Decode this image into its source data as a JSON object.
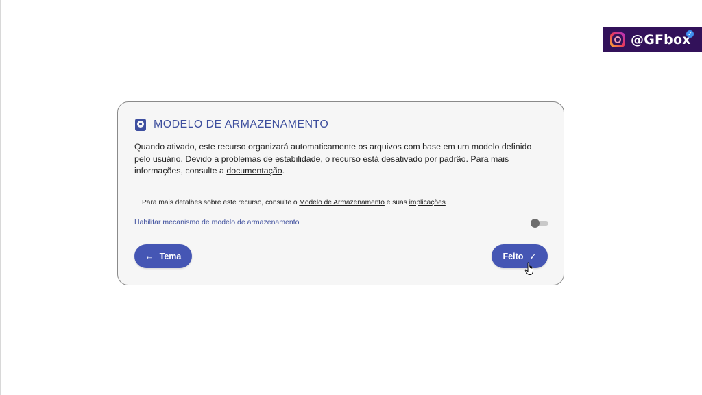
{
  "watermark": {
    "handle": "@GFbox",
    "icon": "instagram-icon",
    "verified_icon": "verified-badge-icon"
  },
  "dialog": {
    "icon": "storage-disk-icon",
    "title": "MODELO DE ARMAZENAMENTO",
    "description_before_link": "Quando ativado, este recurso organizará automaticamente os arquivos com base em um modelo definido pelo usuário. Devido a problemas de estabilidade, o recurso está desativado por padrão. Para mais informações, consulte a ",
    "description_link": "documentação",
    "description_after_link": ".",
    "details_prefix": "Para mais detalhes sobre este recurso, consulte o ",
    "details_link_1": "Modelo de Armazenamento",
    "details_middle": " e suas ",
    "details_link_2": "implicações",
    "setting_label": "Habilitar mecanismo de modelo de armazenamento",
    "setting_enabled": false,
    "back_button": {
      "arrow": "←",
      "label": "Tema"
    },
    "done_button": {
      "label": "Feito",
      "check": "✓"
    }
  },
  "colors": {
    "accent": "#4556b4",
    "title": "#3e4f9e",
    "badge_background": "#32115a",
    "card_background": "#f6f6f6"
  }
}
